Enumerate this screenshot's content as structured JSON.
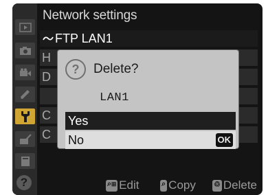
{
  "header": {
    "title": "Network settings"
  },
  "menu": {
    "selected_label": "FTP LAN1",
    "rows": [
      "H",
      "D",
      "",
      "C",
      "C"
    ]
  },
  "dialog": {
    "question": "Delete?",
    "item_name": "LAN1",
    "options": {
      "yes": "Yes",
      "no": "No"
    },
    "ok_badge": "OK"
  },
  "helpbar": {
    "edit": "Edit",
    "copy": "Copy",
    "delete": "Delete",
    "help_glyph": "?"
  },
  "colors": {
    "accent": "#d1a533",
    "screen_bg": "#141414",
    "dialog_bg": "#c4c4c4",
    "highlight": "#1f1f1f"
  },
  "icons": {
    "tabs": [
      "playback-icon",
      "camera-icon",
      "movie-icon",
      "pencil-icon",
      "wrench-icon",
      "retouch-icon",
      "my-menu-icon"
    ],
    "dialog": "question-icon",
    "selected_row": "ftp-connection-icon"
  }
}
